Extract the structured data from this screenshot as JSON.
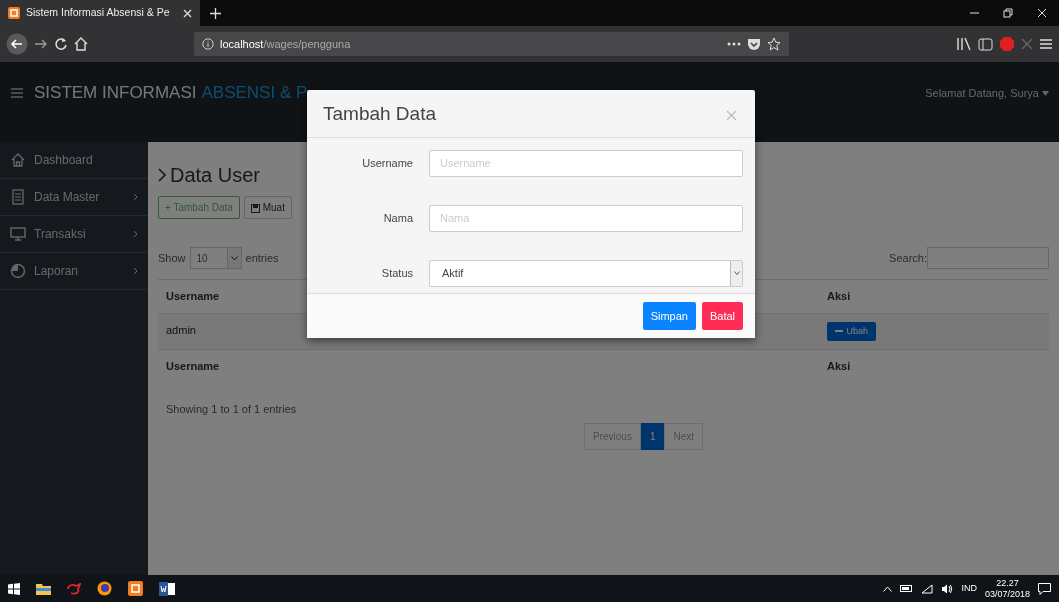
{
  "browser": {
    "tab_title": "Sistem Informasi Absensi & Pe",
    "url_host": "localhost",
    "url_path": "/wages/pengguna"
  },
  "navbar": {
    "brand_first": "SISTEM INFORMASI",
    "brand_second": "ABSENSI & P",
    "user_greeting": "Selamat Datang, Surya"
  },
  "sidebar": {
    "items": [
      {
        "label": "Dashboard",
        "has_submenu": false
      },
      {
        "label": "Data Master",
        "has_submenu": true
      },
      {
        "label": "Transaksi",
        "has_submenu": true
      },
      {
        "label": "Laporan",
        "has_submenu": true
      }
    ]
  },
  "page": {
    "title": "Data User",
    "buttons": [
      {
        "label": "+ Tambah Data",
        "kind": "success"
      },
      {
        "label": "Muat",
        "kind": "default"
      }
    ],
    "length": {
      "prefix": "Show",
      "value": "10",
      "suffix": "entries"
    },
    "search_label": "Search:",
    "table": {
      "columns": [
        "Username",
        "Aksi"
      ],
      "rows": [
        {
          "username": "admin",
          "action": "Ubah"
        }
      ],
      "footer": [
        "Username",
        "Aksi"
      ]
    },
    "info": "Showing 1 to 1 of 1 entries",
    "pagination": [
      {
        "label": "Previous",
        "selected": false
      },
      {
        "label": "1",
        "selected": true
      },
      {
        "label": "Next",
        "selected": false
      }
    ]
  },
  "modal": {
    "title": "Tambah Data",
    "fields": [
      {
        "label": "Username",
        "kind": "text",
        "placeholder": "Username"
      },
      {
        "label": "Nama",
        "kind": "text",
        "placeholder": "Nama"
      },
      {
        "label": "Status",
        "kind": "select",
        "value": "Aktif"
      }
    ],
    "buttons": [
      {
        "label": "Simpan",
        "kind": "primary"
      },
      {
        "label": "Batal",
        "kind": "danger"
      }
    ]
  },
  "taskbar": {
    "language": "IND",
    "time": "22.27",
    "date": "03/07/2018"
  }
}
